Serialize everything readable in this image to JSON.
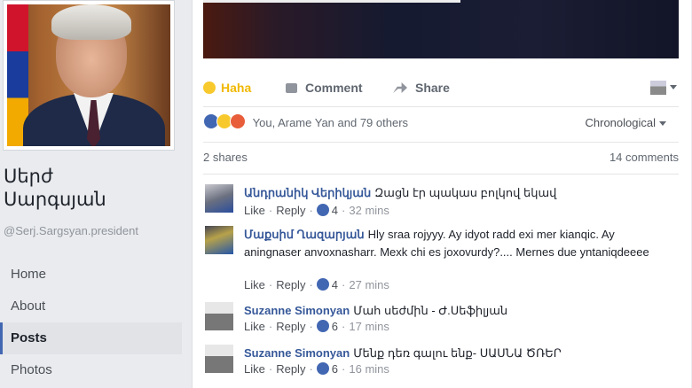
{
  "profile": {
    "name_line1": "Սերժ",
    "name_line2": "Սարգսյան",
    "handle": "@Serj.Sargsyan.president"
  },
  "nav": [
    "Home",
    "About",
    "Posts",
    "Photos"
  ],
  "nav_active": "Posts",
  "post": {
    "actions": {
      "haha": "Haha",
      "comment": "Comment",
      "share": "Share"
    },
    "reactions_text": "You, Arame Yan and 79 others",
    "sort_label": "Chronological",
    "shares": "2 shares",
    "comments_count": "14 comments"
  },
  "comments": [
    {
      "author": "Անդրանիկ Վերիկյան",
      "text": "Զացն էր պակաս բոլկով եկավ",
      "like": "Like",
      "reply": "Reply",
      "reactions": "4",
      "time": "32 mins"
    },
    {
      "author": "Մաքսիմ Ղազարյան",
      "text": "Hly sraa rojyyy. Ay idyot radd exi mer kianqic. Ay aningnaser anvoxnasharr. Mexk chi es joxovurdy?.... Mernes due yntaniqdeeee",
      "like": "Like",
      "reply": "Reply",
      "reactions": "4",
      "time": "27 mins"
    },
    {
      "author": "Suzanne Simonyan",
      "text": "Մահ սեժմին - Ժ.Սեֆիլյան",
      "like": "Like",
      "reply": "Reply",
      "reactions": "6",
      "time": "17 mins"
    },
    {
      "author": "Suzanne Simonyan",
      "text": "Մենք դեռ գալու ենք- ՍԱՍՆԱ ԾՌԵՐ",
      "like": "Like",
      "reply": "Reply",
      "reactions": "6",
      "time": "16 mins"
    }
  ]
}
